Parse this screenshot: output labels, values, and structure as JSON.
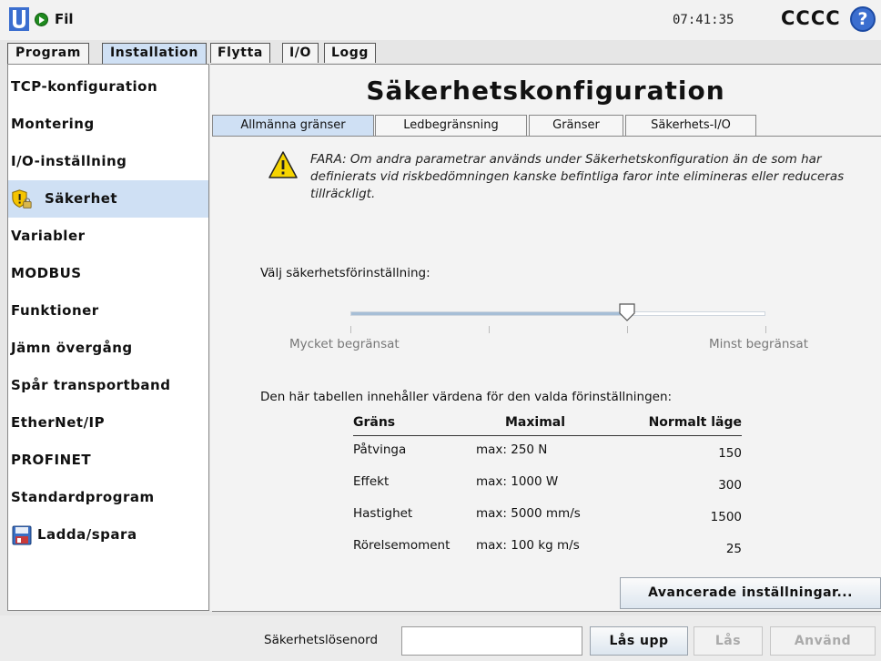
{
  "topbar": {
    "file_label": "Fil",
    "clock": "07:41:35",
    "robot_name": "CCCC",
    "help_glyph": "?"
  },
  "main_tabs": [
    {
      "label": "Program",
      "active": false
    },
    {
      "label": "Installation",
      "active": true
    }
  ],
  "sub_tabs": [
    "Flytta",
    "I/O",
    "Logg"
  ],
  "sidebar": {
    "items": [
      {
        "label": "TCP-konfiguration"
      },
      {
        "label": "Montering"
      },
      {
        "label": "I/O-inställning"
      },
      {
        "label": "Säkerhet",
        "icon": "shield-warning-lock-icon",
        "active": true
      },
      {
        "label": "Variabler"
      },
      {
        "label": "MODBUS"
      },
      {
        "label": "Funktioner"
      },
      {
        "label": "Jämn övergång"
      },
      {
        "label": "Spår transportband"
      },
      {
        "label": "EtherNet/IP"
      },
      {
        "label": "PROFINET"
      },
      {
        "label": "Standardprogram"
      },
      {
        "label": "Ladda/spara",
        "icon": "floppy-disk-icon"
      }
    ]
  },
  "content": {
    "title": "Säkerhetskonfiguration",
    "tabs": [
      {
        "label": "Allmänna gränser",
        "active": true
      },
      {
        "label": "Ledbegränsning",
        "active": false
      },
      {
        "label": "Gränser",
        "active": false
      },
      {
        "label": "Säkerhets-I/O",
        "active": false
      }
    ],
    "warning": "FARA: Om andra parametrar används under Säkerhetskonfiguration än de som har definierats vid riskbedömningen kanske befintliga faror inte elimineras eller reduceras tillräckligt.",
    "preset_label": "Välj säkerhetsförinställning:",
    "slider": {
      "min_label": "Mycket begränsat",
      "max_label": "Minst begränsat",
      "steps": 4,
      "value_index": 2
    },
    "table_intro": "Den här tabellen innehåller värdena för den valda förinställningen:",
    "table": {
      "headers": [
        "Gräns",
        "Maximal",
        "Normalt läge"
      ],
      "rows": [
        {
          "name": "Påtvinga",
          "max": "max: 250 N",
          "normal": "150"
        },
        {
          "name": "Effekt",
          "max": "max: 1000 W",
          "normal": "300"
        },
        {
          "name": "Hastighet",
          "max": "max: 5000 mm/s",
          "normal": "1500"
        },
        {
          "name": "Rörelsemoment",
          "max": "max: 100 kg m/s",
          "normal": "25"
        }
      ]
    },
    "advanced_button": "Avancerade inställningar..."
  },
  "bottombar": {
    "password_label": "Säkerhetslösenord",
    "password_value": "",
    "unlock_button": "Lås upp",
    "lock_button": "Lås",
    "apply_button": "Använd"
  },
  "colors": {
    "active_tab": "#cfe0f4",
    "status_running": "#1f8a1f",
    "help": "#3b6ecf",
    "warning": "#f5d400"
  }
}
